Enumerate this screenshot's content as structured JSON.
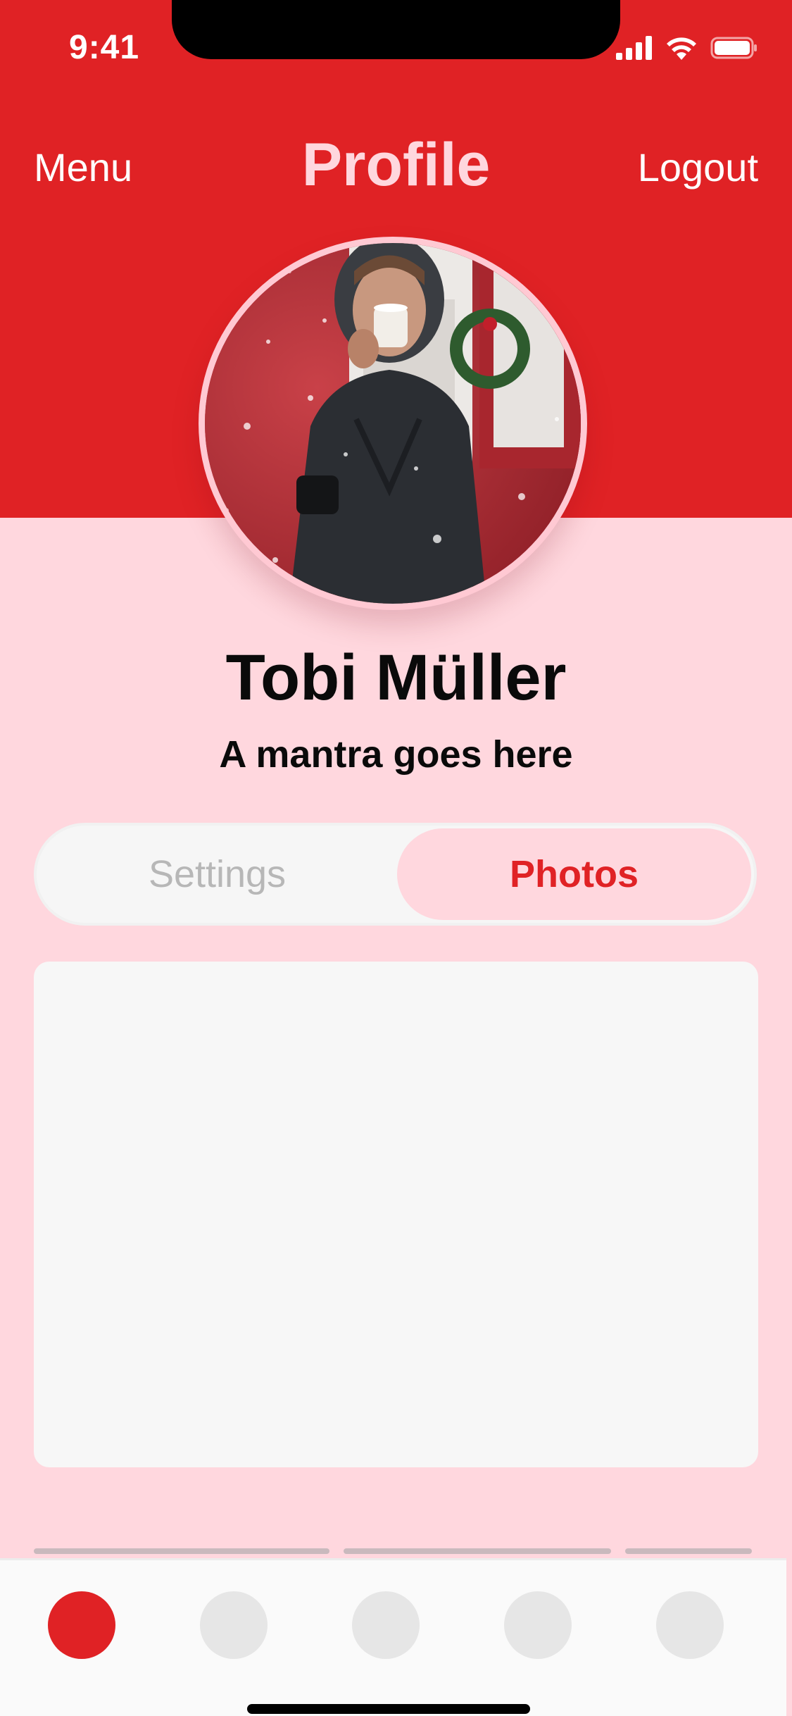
{
  "status_bar": {
    "time": "9:41"
  },
  "header": {
    "menu_label": "Menu",
    "title": "Profile",
    "logout_label": "Logout"
  },
  "profile": {
    "name": "Tobi Müller",
    "mantra": "A mantra goes here"
  },
  "segmented": {
    "settings_label": "Settings",
    "photos_label": "Photos",
    "selected": "Photos"
  },
  "tab_bar": {
    "tabs": [
      "tab-1",
      "tab-2",
      "tab-3",
      "tab-4",
      "tab-5"
    ],
    "active_index": 0
  },
  "colors": {
    "brand": "#E02225",
    "background": "#FFD7DE",
    "card": "#F7F7F7"
  }
}
